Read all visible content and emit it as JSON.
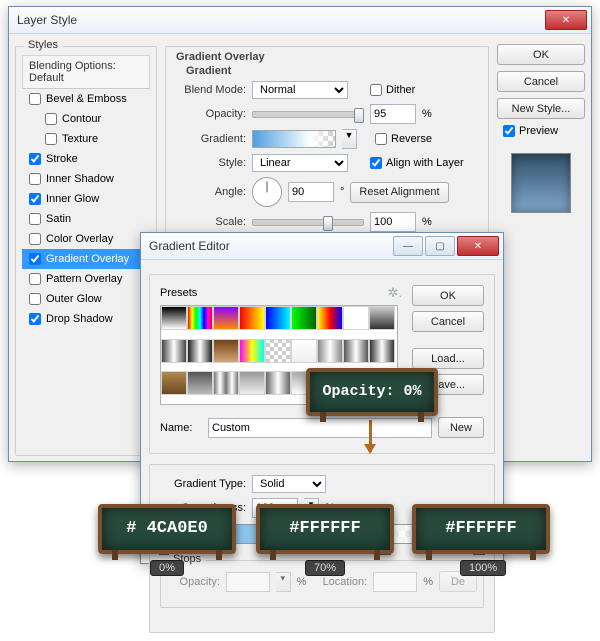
{
  "layerStyle": {
    "title": "Layer Style",
    "styles": {
      "legend": "Styles",
      "header": "Blending Options: Default",
      "items": [
        {
          "label": "Bevel & Emboss",
          "checked": false,
          "indent": 0
        },
        {
          "label": "Contour",
          "checked": false,
          "indent": 1
        },
        {
          "label": "Texture",
          "checked": false,
          "indent": 1
        },
        {
          "label": "Stroke",
          "checked": true,
          "indent": 0
        },
        {
          "label": "Inner Shadow",
          "checked": false,
          "indent": 0
        },
        {
          "label": "Inner Glow",
          "checked": true,
          "indent": 0
        },
        {
          "label": "Satin",
          "checked": false,
          "indent": 0
        },
        {
          "label": "Color Overlay",
          "checked": false,
          "indent": 0
        },
        {
          "label": "Gradient Overlay",
          "checked": true,
          "indent": 0,
          "selected": true
        },
        {
          "label": "Pattern Overlay",
          "checked": false,
          "indent": 0
        },
        {
          "label": "Outer Glow",
          "checked": false,
          "indent": 0
        },
        {
          "label": "Drop Shadow",
          "checked": true,
          "indent": 0
        }
      ]
    },
    "panel": {
      "heading": "Gradient Overlay",
      "sub": "Gradient",
      "blendMode": {
        "label": "Blend Mode:",
        "value": "Normal"
      },
      "dither": {
        "label": "Dither",
        "checked": false
      },
      "opacity": {
        "label": "Opacity:",
        "value": "95",
        "unit": "%"
      },
      "gradient": {
        "label": "Gradient:"
      },
      "reverse": {
        "label": "Reverse",
        "checked": false
      },
      "style": {
        "label": "Style:",
        "value": "Linear"
      },
      "align": {
        "label": "Align with Layer",
        "checked": true
      },
      "angle": {
        "label": "Angle:",
        "value": "90",
        "unit": "°",
        "reset": "Reset Alignment"
      },
      "scale": {
        "label": "Scale:",
        "value": "100",
        "unit": "%"
      }
    },
    "right": {
      "ok": "OK",
      "cancel": "Cancel",
      "newStyle": "New Style...",
      "preview": {
        "label": "Preview",
        "checked": true
      }
    }
  },
  "gradientEditor": {
    "title": "Gradient Editor",
    "presetsLabel": "Presets",
    "right": {
      "ok": "OK",
      "cancel": "Cancel",
      "load": "Load...",
      "save": "Save..."
    },
    "name": {
      "label": "Name:",
      "value": "Custom",
      "new": "New"
    },
    "type": {
      "label": "Gradient Type:",
      "value": "Solid"
    },
    "smoothness": {
      "label": "Smoothness:",
      "value": "100",
      "unit": "%"
    },
    "stopsLabel": "Stops",
    "stops": {
      "opacity": [
        {
          "pos": 0,
          "value": 100
        },
        {
          "pos": 70,
          "value": 100
        },
        {
          "pos": 100,
          "value": 0
        }
      ],
      "color": [
        {
          "pos": 0,
          "hex": "#4CA0E0"
        },
        {
          "pos": 70,
          "hex": "#FFFFFF"
        },
        {
          "pos": 100,
          "hex": "#FFFFFF"
        }
      ]
    },
    "presetSwatches": [
      "linear-gradient(#000,#fff)",
      "linear-gradient(to right,#f00,#ff0,#0f0,#0ff,#00f,#f0f,#f00)",
      "linear-gradient(#8f00ff,#ff8c00)",
      "linear-gradient(to right,#f00,#ff0)",
      "linear-gradient(to right,#00f,#0ff)",
      "linear-gradient(to right,#0f0,#006400)",
      "linear-gradient(to right,#ff0,#f00,#00f)",
      "linear-gradient(#fff,#fff)",
      "linear-gradient(#ccc,#333)",
      "linear-gradient(to right,#444,#fff,#444)",
      "linear-gradient(to right,#222,#fff,#222)",
      "linear-gradient(#704214,#d2a679)",
      "linear-gradient(to right,#f0f,#ff0,#0ff)",
      "repeating-conic-gradient(#ccc 0 25%, #fff 0 50%) 0/8px 8px",
      "linear-gradient(#fff,#eee)",
      "linear-gradient(to right,#888,#fff,#888)",
      "linear-gradient(to right,#555,#fff,#555)",
      "linear-gradient(to right,#333,#fff,#333)",
      "linear-gradient(#b08850,#6b4a20)",
      "linear-gradient(#555,#bbb)",
      "linear-gradient(to right,#777,#fff,#777,#fff,#777)",
      "linear-gradient(#999,#eee)",
      "linear-gradient(to right,#666,#fff,#666)",
      "linear-gradient(#aaa,#fff)",
      "linear-gradient(to right,#444,#fff,#444)",
      "linear-gradient(#bbb,#fff)",
      "linear-gradient(to right,#888,#fff,#888)"
    ]
  },
  "annotations": {
    "opacityBoard": "Opacity: 0%",
    "colorBoards": [
      "# 4CA0E0",
      "#FFFFFF",
      "#FFFFFF"
    ],
    "percents": [
      "0%",
      "70%",
      "100%"
    ]
  }
}
